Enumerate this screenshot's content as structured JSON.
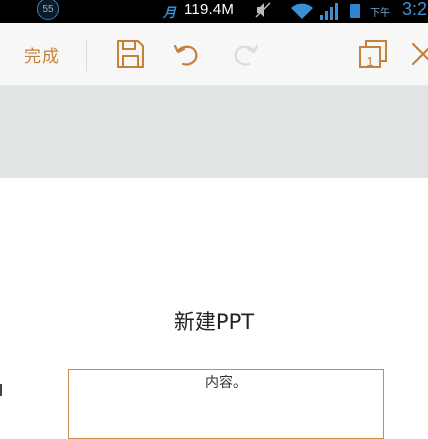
{
  "status_bar": {
    "notification_count": "55",
    "sim_label": "月",
    "network_speed": "119.4M",
    "ampm": "下午",
    "time": "3:2"
  },
  "toolbar": {
    "done_label": "完成",
    "icon_color": "#c4813a",
    "redo_disabled_color": "#dcdcdc",
    "slide_number": "1"
  },
  "slide": {
    "title": "新建PPT",
    "content_label": "内容。",
    "placeholder_border_color": "#c98a4a"
  },
  "colors": {
    "accent": "#c4813a",
    "gray_band": "#e1e5e6",
    "status_bar_bg": "#000000",
    "status_blue": "#3b8fd6"
  }
}
